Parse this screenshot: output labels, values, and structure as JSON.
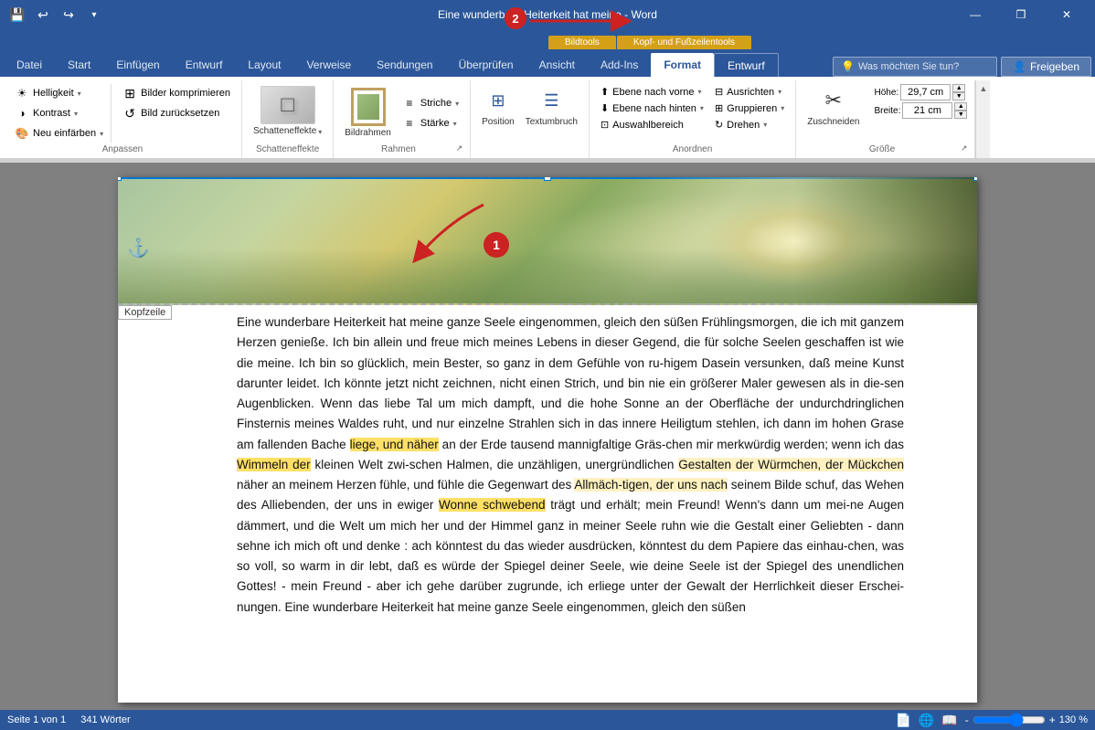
{
  "titlebar": {
    "title": "Eine wunderbare Heiterkeit hat meine - Word",
    "save_icon": "💾",
    "undo_icon": "↩",
    "redo_icon": "↪",
    "customize_icon": "▾",
    "minimize": "🗕",
    "restore": "🗗",
    "close": "✕",
    "badge2_label": "2",
    "arrow_label": "→"
  },
  "context_tabs": [
    {
      "label": "Bildtools",
      "style": "orange"
    },
    {
      "label": "Kopf- und Fußzeilentools",
      "style": "orange"
    }
  ],
  "ribbon_tabs": [
    {
      "label": "Datei",
      "active": false
    },
    {
      "label": "Start",
      "active": false
    },
    {
      "label": "Einfügen",
      "active": false
    },
    {
      "label": "Entwurf",
      "active": false
    },
    {
      "label": "Layout",
      "active": false
    },
    {
      "label": "Verweise",
      "active": false
    },
    {
      "label": "Sendungen",
      "active": false
    },
    {
      "label": "Überprüfen",
      "active": false
    },
    {
      "label": "Ansicht",
      "active": false
    },
    {
      "label": "Add-Ins",
      "active": false
    },
    {
      "label": "Format",
      "active": true
    },
    {
      "label": "Entwurf",
      "active": false,
      "accent": true
    }
  ],
  "header_search": {
    "placeholder": "Was möchten Sie tun?",
    "icon": "💡"
  },
  "freigeben": {
    "label": "Freigeben",
    "icon": "👤"
  },
  "ribbon_groups": {
    "anpassen": {
      "label": "Anpassen",
      "buttons": [
        {
          "label": "Helligkeit",
          "icon": "☀",
          "has_dropdown": true
        },
        {
          "label": "Kontrast",
          "icon": "◑",
          "has_dropdown": true
        },
        {
          "label": "Neu einfärben",
          "icon": "🎨",
          "has_dropdown": true
        }
      ],
      "right_buttons": [
        {
          "label": "Bilder komprimieren"
        },
        {
          "label": "Bild zurücksetzen"
        }
      ]
    },
    "schatteneffekte": {
      "label": "Schatteneffekte",
      "main_label": "Schatteneffekte",
      "has_dropdown": true
    },
    "rahmen": {
      "label": "Rahmen",
      "bildrahmen_label": "Bildrahmen",
      "striche_label": "Striche",
      "starke_label": "Stärke",
      "has_dialog_launcher": true
    },
    "position_group": {
      "position_label": "Position",
      "textumbruch_label": "Textumbruch"
    },
    "anordnen": {
      "label": "Anordnen",
      "buttons": [
        {
          "label": "Ebene nach vorne",
          "has_dropdown": true
        },
        {
          "label": "Ebene nach hinten",
          "has_dropdown": true
        },
        {
          "label": "Auswahlbereich"
        },
        {
          "label": "Ausrichten",
          "has_dropdown": true
        },
        {
          "label": "Gruppieren",
          "has_dropdown": true
        },
        {
          "label": "Drehen",
          "has_dropdown": true
        }
      ]
    },
    "grosse": {
      "label": "Größe",
      "hohe_label": "Höhe:",
      "breite_label": "Breite:",
      "hohe_value": "29,7 cm",
      "breite_value": "21 cm",
      "unit": "cm",
      "zuschneiden_label": "Zuschneiden",
      "has_dialog_launcher": true
    }
  },
  "document": {
    "kopfzeile_label": "Kopfzeile",
    "annotation_1": "1",
    "annotation_2": "2",
    "text": "Eine wunderbare Heiterkeit hat meine ganze Seele eingenommen, gleich den süßen Frühlingsmorgen, die ich mit ganzem Herzen genieße. Ich bin allein und freue mich meines Lebens in dieser Gegend, die für solche Seelen geschaffen ist wie die meine. Ich bin so glücklich, mein Bester, so ganz in dem Gefühle von ru-higem Dasein versunken, daß meine Kunst darunter leidet. Ich könnte jetzt nicht zeichnen, nicht einen Strich, und bin nie ein größerer Maler gewesen als in die-sen Augenblicken. Wenn das liebe Tal um mich dampft, und die hohe Sonne an der Oberfläche der undurchdringlichen Finsternis meines Waldes ruht, und nur einzelne Strahlen sich in das innere Heiligtum stehlen, ich dann im hohen Grase am fallenden Bache liege, und näher an der Erde tausend mannigfaltige Gräs-chen mir merkwürdig werden; wenn ich das Wimmeln der kleinen Welt zwi-schen Halmen, die unzähligen, unergründlichen Gestalten der Würmchen, der Mückchen näher an meinem Herzen fühle, und fühle die Gegenwart des Allmäch-tigen, der uns nach seinem Bilde schuf, das Wehen des Alliebenden, der uns in ewiger Wonne schwebend trägt und erhält; mein Freund! Wenn's dann um mei-ne Augen dämmert, und die Welt um mich her und der Himmel ganz in meiner Seele ruhn wie die Gestalt einer Geliebten - dann sehne ich mich oft und denke : ach könntest du das wieder ausdrücken, könntest du dem Papiere das einhau-chen, was so voll, so warm in dir lebt, daß es würde der Spiegel deiner Seele, wie deine Seele ist der Spiegel des unendlichen Gottes! - mein Freund - aber ich gehe darüber zugrunde, ich erliege unter der Gewalt der Herrlichkeit dieser Erschei-nungen. Eine wunderbare Heiterkeit hat meine ganze Seele eingenommen, gleich den süßen",
    "highlighted_words": [
      "liege, und näher",
      "Wimmeln der kleinen",
      "Halmen, die unzähligen, unergründlichen Gestalten der Würmchen, der Mückchen",
      "Allmäch-tigen, der uns nach",
      "Wonne schwebend"
    ]
  },
  "statusbar": {
    "page_info": "Seite 1 von 1",
    "word_count": "341 Wörter",
    "zoom": "130 %",
    "zoom_minus": "-",
    "zoom_plus": "+"
  }
}
